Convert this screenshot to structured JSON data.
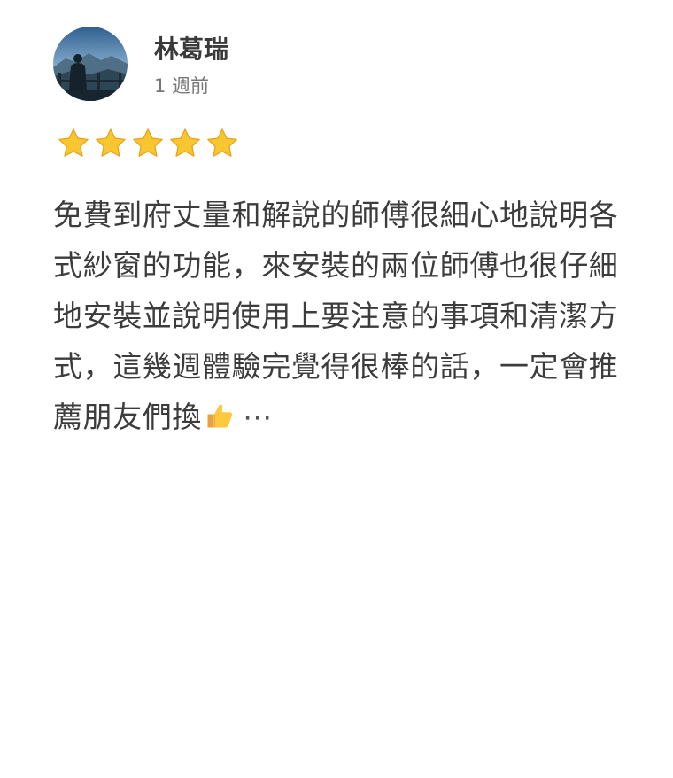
{
  "reviewer": {
    "name": "林葛瑞",
    "time_ago": "1 週前",
    "avatar_icon": "profile-photo-mountain-view"
  },
  "rating": {
    "stars": 5,
    "max": 5,
    "star_color": "#F8C630"
  },
  "review": {
    "text": "免費到府丈量和解說的師傅很細心地說明各式紗窗的功能，來安裝的兩位師傅也很仔細地安裝並說明使用上要注意的事項和清潔方式，這幾週體驗完覺得很棒的話，一定會推薦朋友們換",
    "emoji_icon": "thumbs-up-icon",
    "more_label": "⋯"
  }
}
